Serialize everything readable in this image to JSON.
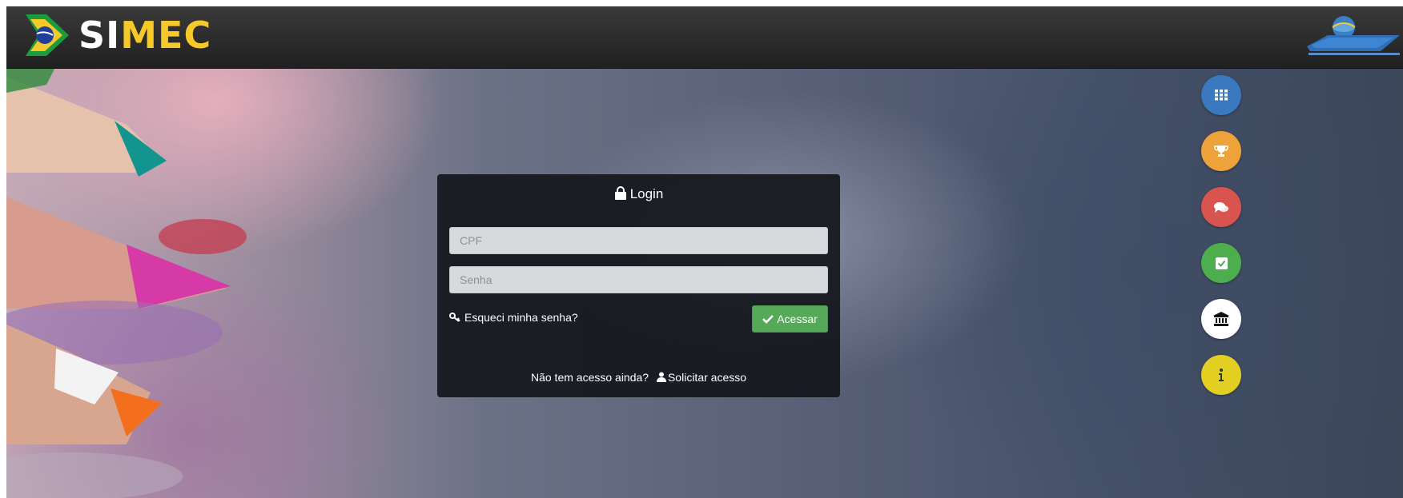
{
  "header": {
    "app_name_part1": "SI",
    "app_name_part2": "MEC"
  },
  "login": {
    "title": "Login",
    "cpf_placeholder": "CPF",
    "senha_placeholder": "Senha",
    "forgot_label": "Esqueci minha senha?",
    "submit_label": "Acessar",
    "no_access_text": "Não tem acesso ainda?",
    "request_access_label": "Solicitar acesso"
  },
  "side_buttons": [
    {
      "icon": "grid-icon",
      "color": "#3a78bf"
    },
    {
      "icon": "trophy-icon",
      "color": "#eea23a"
    },
    {
      "icon": "chat-icon",
      "color": "#d9534f"
    },
    {
      "icon": "check-square-icon",
      "color": "#4cae4c"
    },
    {
      "icon": "institution-icon",
      "color": "#ffffff"
    },
    {
      "icon": "info-icon",
      "color": "#e3cf22"
    }
  ],
  "colors": {
    "navbar": "#2b2b2b",
    "logo_yellow": "#f6c92b",
    "login_button": "#55a959"
  }
}
